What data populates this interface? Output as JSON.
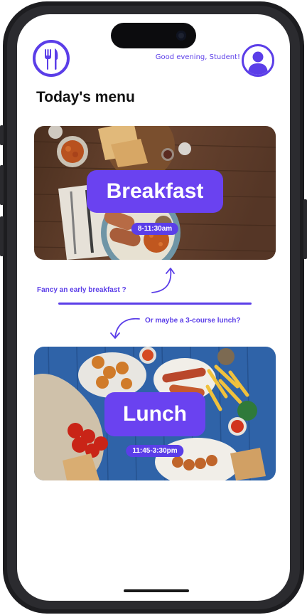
{
  "header": {
    "greeting": "Good evening, Student!",
    "logo_icon": "fork-knife-icon",
    "avatar_icon": "user-avatar-icon"
  },
  "title": "Today's menu",
  "meals": [
    {
      "name": "Breakfast",
      "time": "8-11:30am"
    },
    {
      "name": "Lunch",
      "time": "11:45-3:30pm"
    }
  ],
  "prompts": {
    "breakfast": "Fancy an early breakfast ?",
    "lunch": "Or maybe a 3-course lunch?"
  },
  "colors": {
    "accent": "#5b3ee8",
    "pill": "#6a42f0"
  }
}
